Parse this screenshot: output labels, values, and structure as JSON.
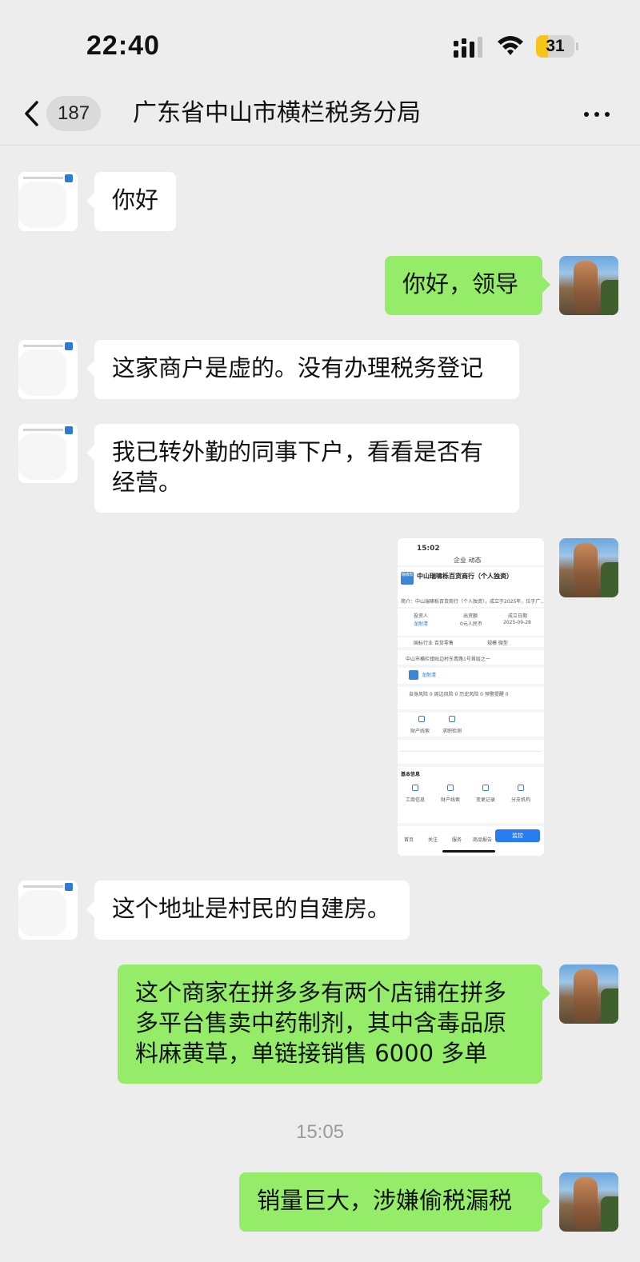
{
  "status_bar": {
    "time": "22:40",
    "battery": "31",
    "battery_level": 0.31
  },
  "header": {
    "unread_count": "187",
    "title": "广东省中山市横栏税务分局"
  },
  "messages": [
    {
      "side": "left",
      "text": "你好"
    },
    {
      "side": "right",
      "text": "你好，领导"
    },
    {
      "side": "left",
      "text": "这家商户是虚的。没有办理税务登记"
    },
    {
      "side": "left",
      "text": "我已转外勤的同事下户，看看是否有经营。"
    },
    {
      "side": "right",
      "type": "image",
      "description_label": "screenshot"
    },
    {
      "side": "left",
      "text": "这个地址是村民的自建房。"
    },
    {
      "side": "right",
      "text": "这个商家在拼多多有两个店铺在拼多多平台售卖中药制剂，其中含毒品原料麻黄草，单链接销售 6000 多单"
    },
    {
      "side": "right",
      "text": "销量巨大，涉嫌偷税漏税"
    }
  ],
  "timestamp": "15:05",
  "shared_screenshot": {
    "time": "15:02",
    "tabs": "企业    动态",
    "company": "中山瑞啸栎百货商行（个人独资）",
    "logo_text": "瑞啸栎",
    "summary": "简介：中山瑞啸栎百货商行（个人独资），成立于2025年，位于广… 更多",
    "legal_rep_label": "投资人",
    "legal_rep": "龙耐清",
    "capital_label": "出资额",
    "capital": "0元人民币",
    "date_label": "成立日期",
    "date": "2025-09-28",
    "industry": "国标行业 百货零售",
    "scale": "规模 微型",
    "address": "中山市横栏镇贴边村东青路1号首层之一",
    "risk_row": "自身风险 0   周边风险 0   历史风险 0   预警提醒 0",
    "service_a": "财产线索",
    "service_b": "求职检测",
    "basic_info": "基本信息",
    "basic_items": [
      "工商信息",
      "财产线索",
      "变更记录",
      "分支机构"
    ],
    "bottom_tabs": [
      "首页",
      "关注",
      "服务",
      "商品报告"
    ],
    "monitor": "监控"
  }
}
